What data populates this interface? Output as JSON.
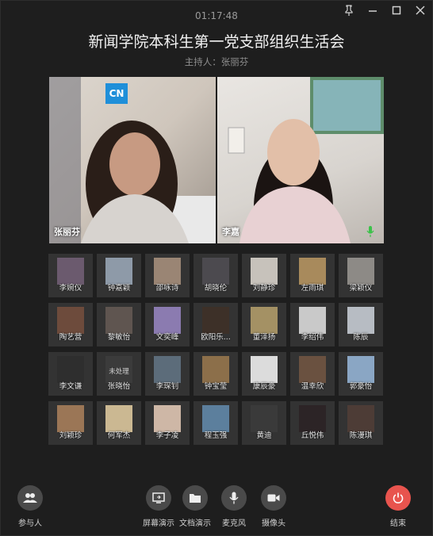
{
  "window": {
    "timer": "01:17:48",
    "title": "新闻学院本科生第一党支部组织生活会",
    "host": "主持人：张丽芬"
  },
  "videos": [
    {
      "name": "张丽芬",
      "badge": "CN"
    },
    {
      "name": "李嘉",
      "mic": "active"
    }
  ],
  "participants": [
    {
      "name": "李婉仪"
    },
    {
      "name": "钟嘉颖"
    },
    {
      "name": "邵咏诗"
    },
    {
      "name": "胡晓伦"
    },
    {
      "name": "刘静珍"
    },
    {
      "name": "左雨琪"
    },
    {
      "name": "梁颖仪"
    },
    {
      "name": "陶艺营"
    },
    {
      "name": "黎敏怡"
    },
    {
      "name": "文奕峰"
    },
    {
      "name": "欧阳乐..."
    },
    {
      "name": "董泽扬"
    },
    {
      "name": "李绍伟"
    },
    {
      "name": "陈辰"
    },
    {
      "name": "李文谦"
    },
    {
      "name": "张晓怡",
      "status": "未处理"
    },
    {
      "name": "李琛钊"
    },
    {
      "name": "钟宝莹"
    },
    {
      "name": "康辰豪"
    },
    {
      "name": "温幸欣"
    },
    {
      "name": "郭豪怡"
    },
    {
      "name": "刘颖珍"
    },
    {
      "name": "何军杰"
    },
    {
      "name": "李子凌"
    },
    {
      "name": "程玉强"
    },
    {
      "name": "黄迪"
    },
    {
      "name": "丘悦伟"
    },
    {
      "name": "陈漫琪"
    }
  ],
  "toolbar": {
    "participants": "参与人",
    "screen_share": "屏幕演示",
    "doc_share": "文档演示",
    "mic": "麦克风",
    "camera": "摄像头",
    "end": "结束"
  },
  "colors": {
    "end": "#e8544e",
    "mic_active": "#3cc24a",
    "background": "#1e1e1e"
  }
}
